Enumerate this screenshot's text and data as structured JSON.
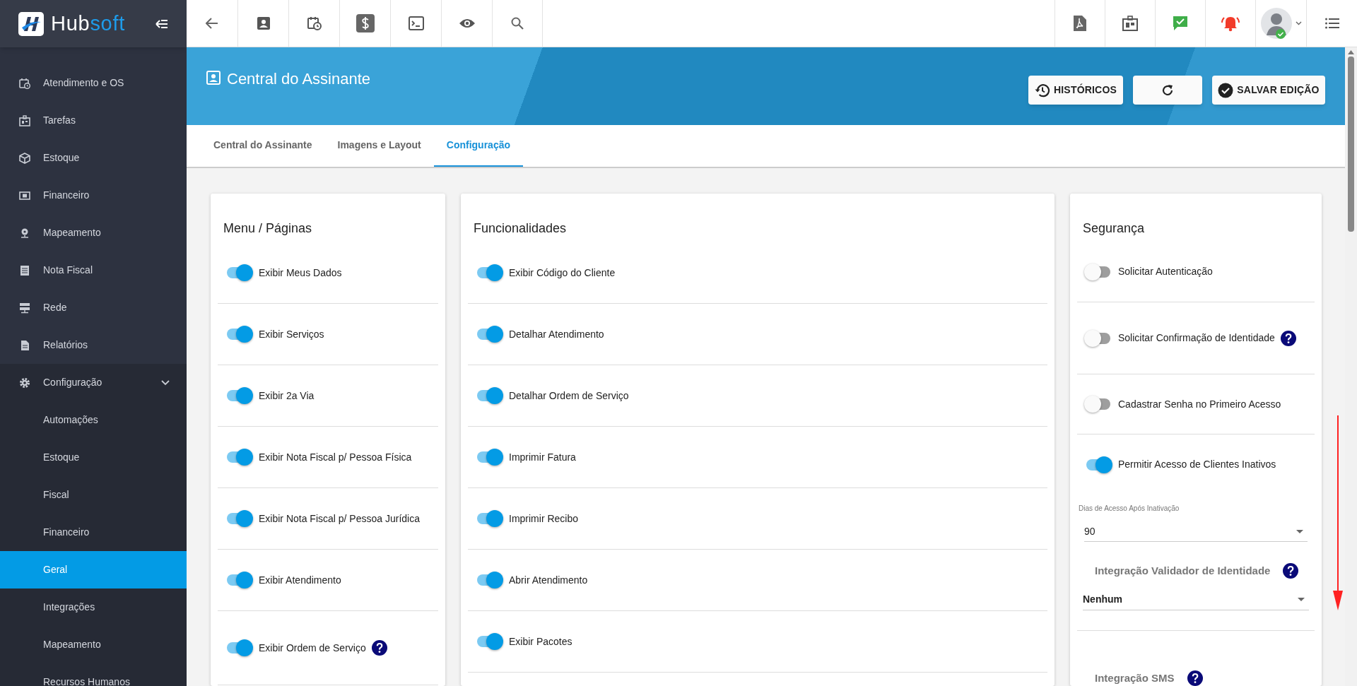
{
  "brand": {
    "name_a": "Hub",
    "name_b": "soft"
  },
  "sidebar": {
    "items": [
      {
        "label": "Atendimento e OS",
        "selected": false
      },
      {
        "label": "Tarefas",
        "selected": false
      },
      {
        "label": "Estoque",
        "selected": false
      },
      {
        "label": "Financeiro",
        "selected": false
      },
      {
        "label": "Mapeamento",
        "selected": false
      },
      {
        "label": "Nota Fiscal",
        "selected": false
      },
      {
        "label": "Rede",
        "selected": false
      },
      {
        "label": "Relatórios",
        "selected": false
      },
      {
        "label": "Configuração",
        "selected": false,
        "expanded": true,
        "children": [
          {
            "label": "Automações",
            "selected": false
          },
          {
            "label": "Estoque",
            "selected": false
          },
          {
            "label": "Fiscal",
            "selected": false
          },
          {
            "label": "Financeiro",
            "selected": false
          },
          {
            "label": "Geral",
            "selected": true
          },
          {
            "label": "Integrações",
            "selected": false
          },
          {
            "label": "Mapeamento",
            "selected": false
          },
          {
            "label": "Recursos Humanos",
            "selected": false
          }
        ]
      }
    ]
  },
  "header": {
    "title": "Central do Assinante",
    "buttons": [
      {
        "kind": "history",
        "label": "HISTÓRICOS"
      },
      {
        "kind": "refresh"
      },
      {
        "kind": "save",
        "label": "SALVAR EDIÇÃO"
      }
    ]
  },
  "tabs": [
    {
      "label": "Central do Assinante",
      "selected": false
    },
    {
      "label": "Imagens e Layout",
      "selected": false
    },
    {
      "label": "Configuração",
      "selected": true
    }
  ],
  "cards": [
    {
      "title": "Menu / Páginas",
      "rows": [
        {
          "kind": "toggle",
          "label": "Exibir Meus Dados",
          "on": true,
          "help": false
        },
        {
          "kind": "toggle",
          "label": "Exibir Serviços",
          "on": true,
          "help": false
        },
        {
          "kind": "toggle",
          "label": "Exibir 2a Via",
          "on": true,
          "help": false
        },
        {
          "kind": "toggle",
          "label": "Exibir Nota Fiscal p/ Pessoa Física",
          "on": true,
          "help": false
        },
        {
          "kind": "toggle",
          "label": "Exibir Nota Fiscal p/ Pessoa Jurídica",
          "on": true,
          "help": false
        },
        {
          "kind": "toggle",
          "label": "Exibir Atendimento",
          "on": true,
          "help": false
        },
        {
          "kind": "toggle",
          "label": "Exibir Ordem de Serviço",
          "on": true,
          "help": true
        }
      ]
    },
    {
      "title": "Funcionalidades",
      "rows": [
        {
          "kind": "toggle",
          "label": "Exibir Código do Cliente",
          "on": true,
          "help": false
        },
        {
          "kind": "toggle",
          "label": "Detalhar Atendimento",
          "on": true,
          "help": false
        },
        {
          "kind": "toggle",
          "label": "Detalhar Ordem de Serviço",
          "on": true,
          "help": false
        },
        {
          "kind": "toggle",
          "label": "Imprimir Fatura",
          "on": true,
          "help": false
        },
        {
          "kind": "toggle",
          "label": "Imprimir Recibo",
          "on": true,
          "help": false
        },
        {
          "kind": "toggle",
          "label": "Abrir Atendimento",
          "on": true,
          "help": false
        },
        {
          "kind": "toggle",
          "label": "Exibir Pacotes",
          "on": true,
          "help": false
        }
      ]
    },
    {
      "title": "Segurança",
      "rows": [
        {
          "kind": "toggle",
          "label": "Solicitar Autenticação",
          "on": false,
          "help": false
        },
        {
          "kind": "toggle",
          "label": "Solicitar Confirmação de Identidade",
          "on": false,
          "help": true
        },
        {
          "kind": "toggle",
          "label": "Cadastrar Senha no Primeiro Acesso",
          "on": false,
          "help": false
        },
        {
          "kind": "toggle",
          "label": "Permitir Acesso de Clientes Inativos",
          "on": true,
          "help": false,
          "field": {
            "label": "Dias de Acesso Após Inativação",
            "value": "90"
          }
        },
        {
          "kind": "integration",
          "label": "Integração Validador de Identidade",
          "help": true,
          "value": "Nenhum"
        },
        {
          "kind": "integration",
          "label": "Integração SMS",
          "help": true
        }
      ]
    }
  ]
}
